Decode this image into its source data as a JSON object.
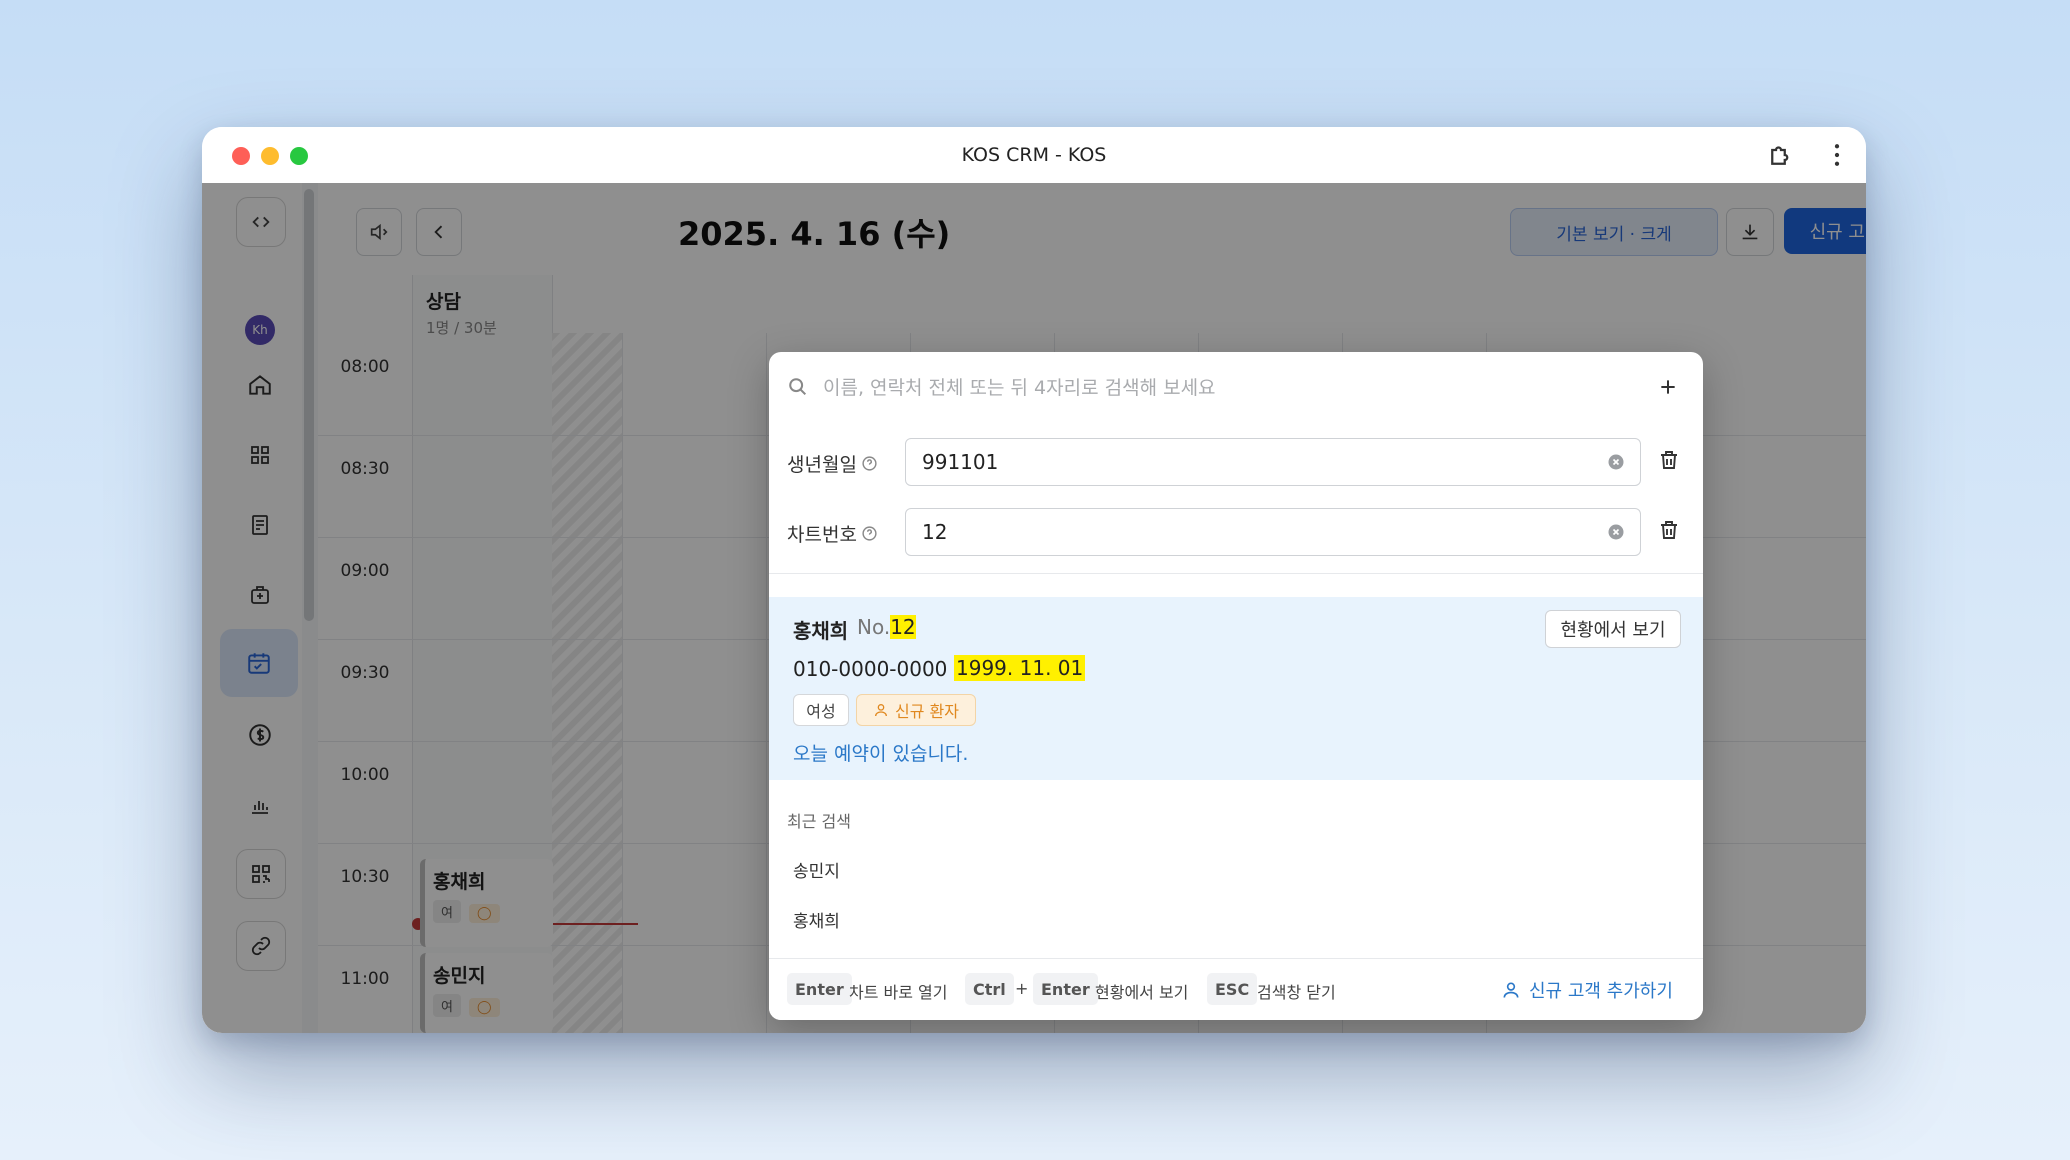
{
  "window": {
    "title": "KOS CRM - KOS"
  },
  "sidebar": {
    "avatar_initials": "Kh"
  },
  "toolbar": {
    "date": "2025. 4. 16 (수)",
    "view_label": "기본 보기 · 크게",
    "add_customer_label": "신규 고객 추가"
  },
  "schedule": {
    "column": {
      "title": "상담",
      "subtitle": "1명 / 30분"
    },
    "times": [
      "08:00",
      "08:30",
      "09:00",
      "09:30",
      "10:00",
      "10:30",
      "11:00"
    ],
    "appointments": [
      {
        "name": "홍채희",
        "chip": "여"
      },
      {
        "name": "송민지",
        "chip": "여"
      }
    ]
  },
  "search": {
    "placeholder": "이름, 연락처 전체 또는 뒤 4자리로 검색해 보세요",
    "filters": [
      {
        "label": "생년월일",
        "value": "991101"
      },
      {
        "label": "차트번호",
        "value": "12"
      }
    ]
  },
  "result": {
    "name": "홍채희",
    "no_prefix": "No.",
    "no_value": "12",
    "phone": "010-0000-0000",
    "birth": "1999. 11. 01",
    "view_button": "현황에서 보기",
    "tags": {
      "gender": "여성",
      "status": "신규 환자"
    },
    "note": "오늘 예약이 있습니다."
  },
  "recent": {
    "title": "최근 검색",
    "items": [
      "송민지",
      "홍채희"
    ]
  },
  "footer": {
    "enter_key": "Enter",
    "enter_hint": "차트 바로 열기",
    "ctrl_key": "Ctrl",
    "plus": "+",
    "ctrl_enter_key": "Enter",
    "ctrl_enter_hint": "현황에서 보기",
    "esc_key": "ESC",
    "esc_hint": "검색창 닫기",
    "add_link": "신규 고객 추가하기"
  },
  "colors": {
    "primary": "#1f67e0",
    "highlight": "#fff000",
    "result_bg": "#e8f3fd",
    "link": "#2b78c8",
    "new_tag": "#e0881f"
  }
}
